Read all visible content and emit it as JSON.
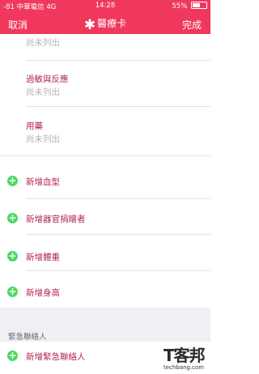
{
  "status_bar": {
    "signal": "-81",
    "carrier": "中華電信",
    "network": "4G",
    "time": "14:28",
    "battery": "55%",
    "battery_level": 0.55
  },
  "nav": {
    "cancel": "取消",
    "title": "醫療卡",
    "done": "完成"
  },
  "fields": [
    {
      "label": "",
      "value": "尚未列出"
    },
    {
      "label": "過敏與反應",
      "value": "尚未列出"
    },
    {
      "label": "用藥",
      "value": "尚未列出"
    }
  ],
  "add_items": [
    "新增血型",
    "新增器官捐贈者",
    "新增體重",
    "新增身高"
  ],
  "emergency": {
    "section_title": "緊急聯絡人",
    "add_label": "新增緊急聯絡人"
  },
  "watermark": {
    "text": "T客邦",
    "site": "techbang.com"
  },
  "colors": {
    "accent": "#f0385c",
    "label": "#b0284e",
    "add_icon": "#4cd964",
    "placeholder": "#b3b3b3"
  }
}
